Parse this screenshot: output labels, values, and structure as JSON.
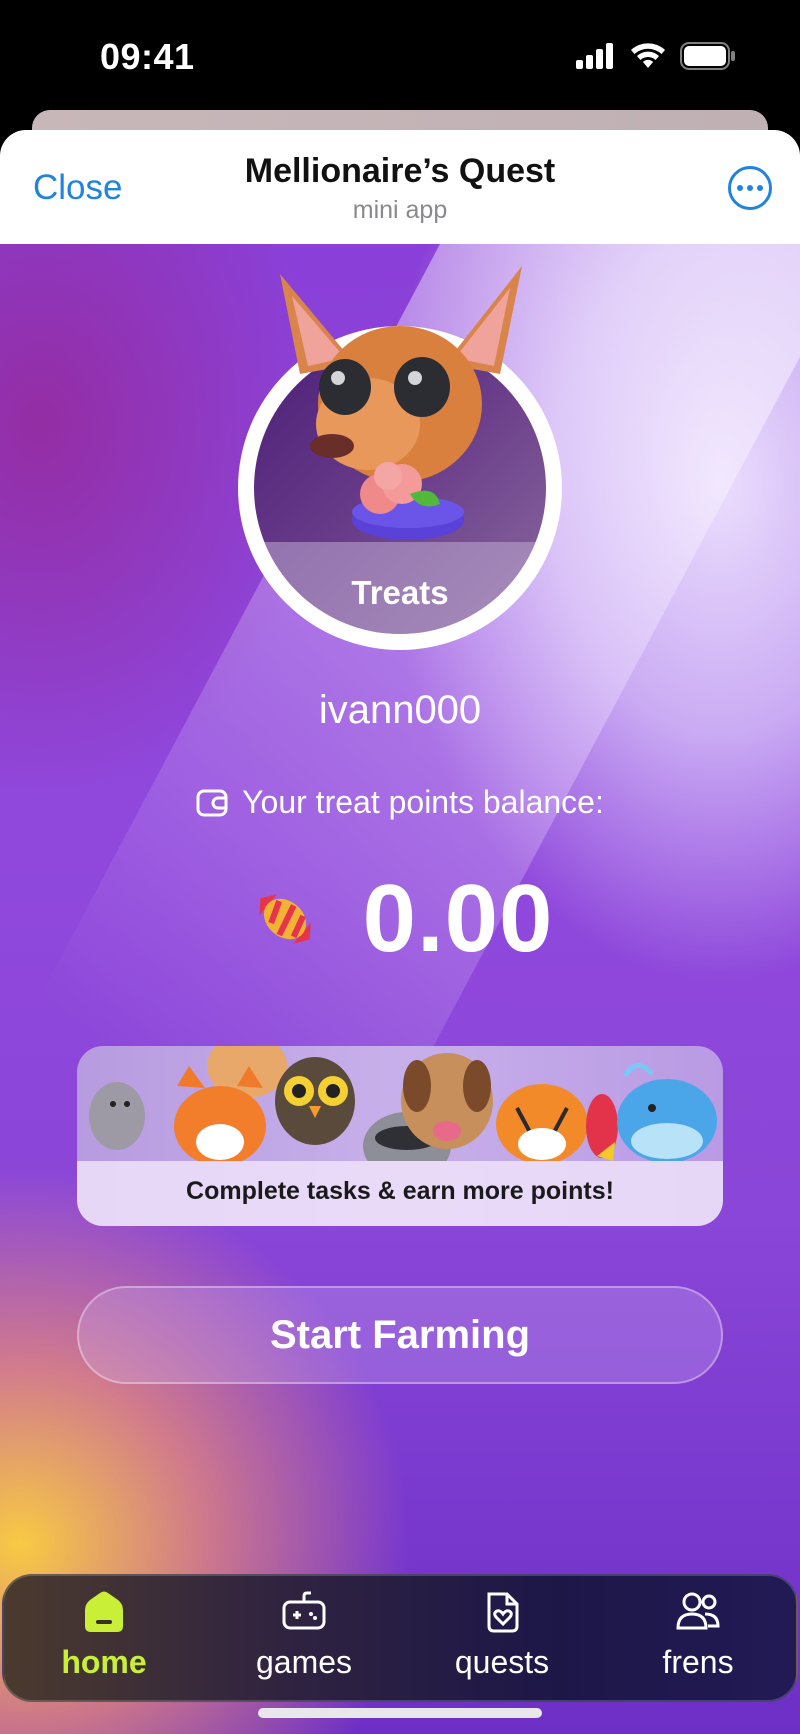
{
  "status_bar": {
    "time": "09:41",
    "icons": [
      "signal-icon",
      "wifi-icon",
      "battery-icon"
    ]
  },
  "header": {
    "close_label": "Close",
    "title": "Mellionaire’s Quest",
    "subtitle": "mini app",
    "more_icon": "more-options-icon"
  },
  "profile": {
    "avatar_label": "Treats",
    "username": "ivann000"
  },
  "balance": {
    "label": "Your treat points balance:",
    "value": "0.00",
    "icon": "candy-icon"
  },
  "banner": {
    "caption": "Complete tasks & earn more points!"
  },
  "actions": {
    "start_label": "Start Farming"
  },
  "nav": {
    "items": [
      {
        "label": "home",
        "icon": "home-icon",
        "active": true
      },
      {
        "label": "games",
        "icon": "gamepad-icon",
        "active": false
      },
      {
        "label": "quests",
        "icon": "quests-icon",
        "active": false
      },
      {
        "label": "frens",
        "icon": "friends-icon",
        "active": false
      }
    ]
  },
  "colors": {
    "accent_blue": "#1f83e0",
    "nav_active": "#c9f037",
    "background_purple": "#8a40d8"
  }
}
